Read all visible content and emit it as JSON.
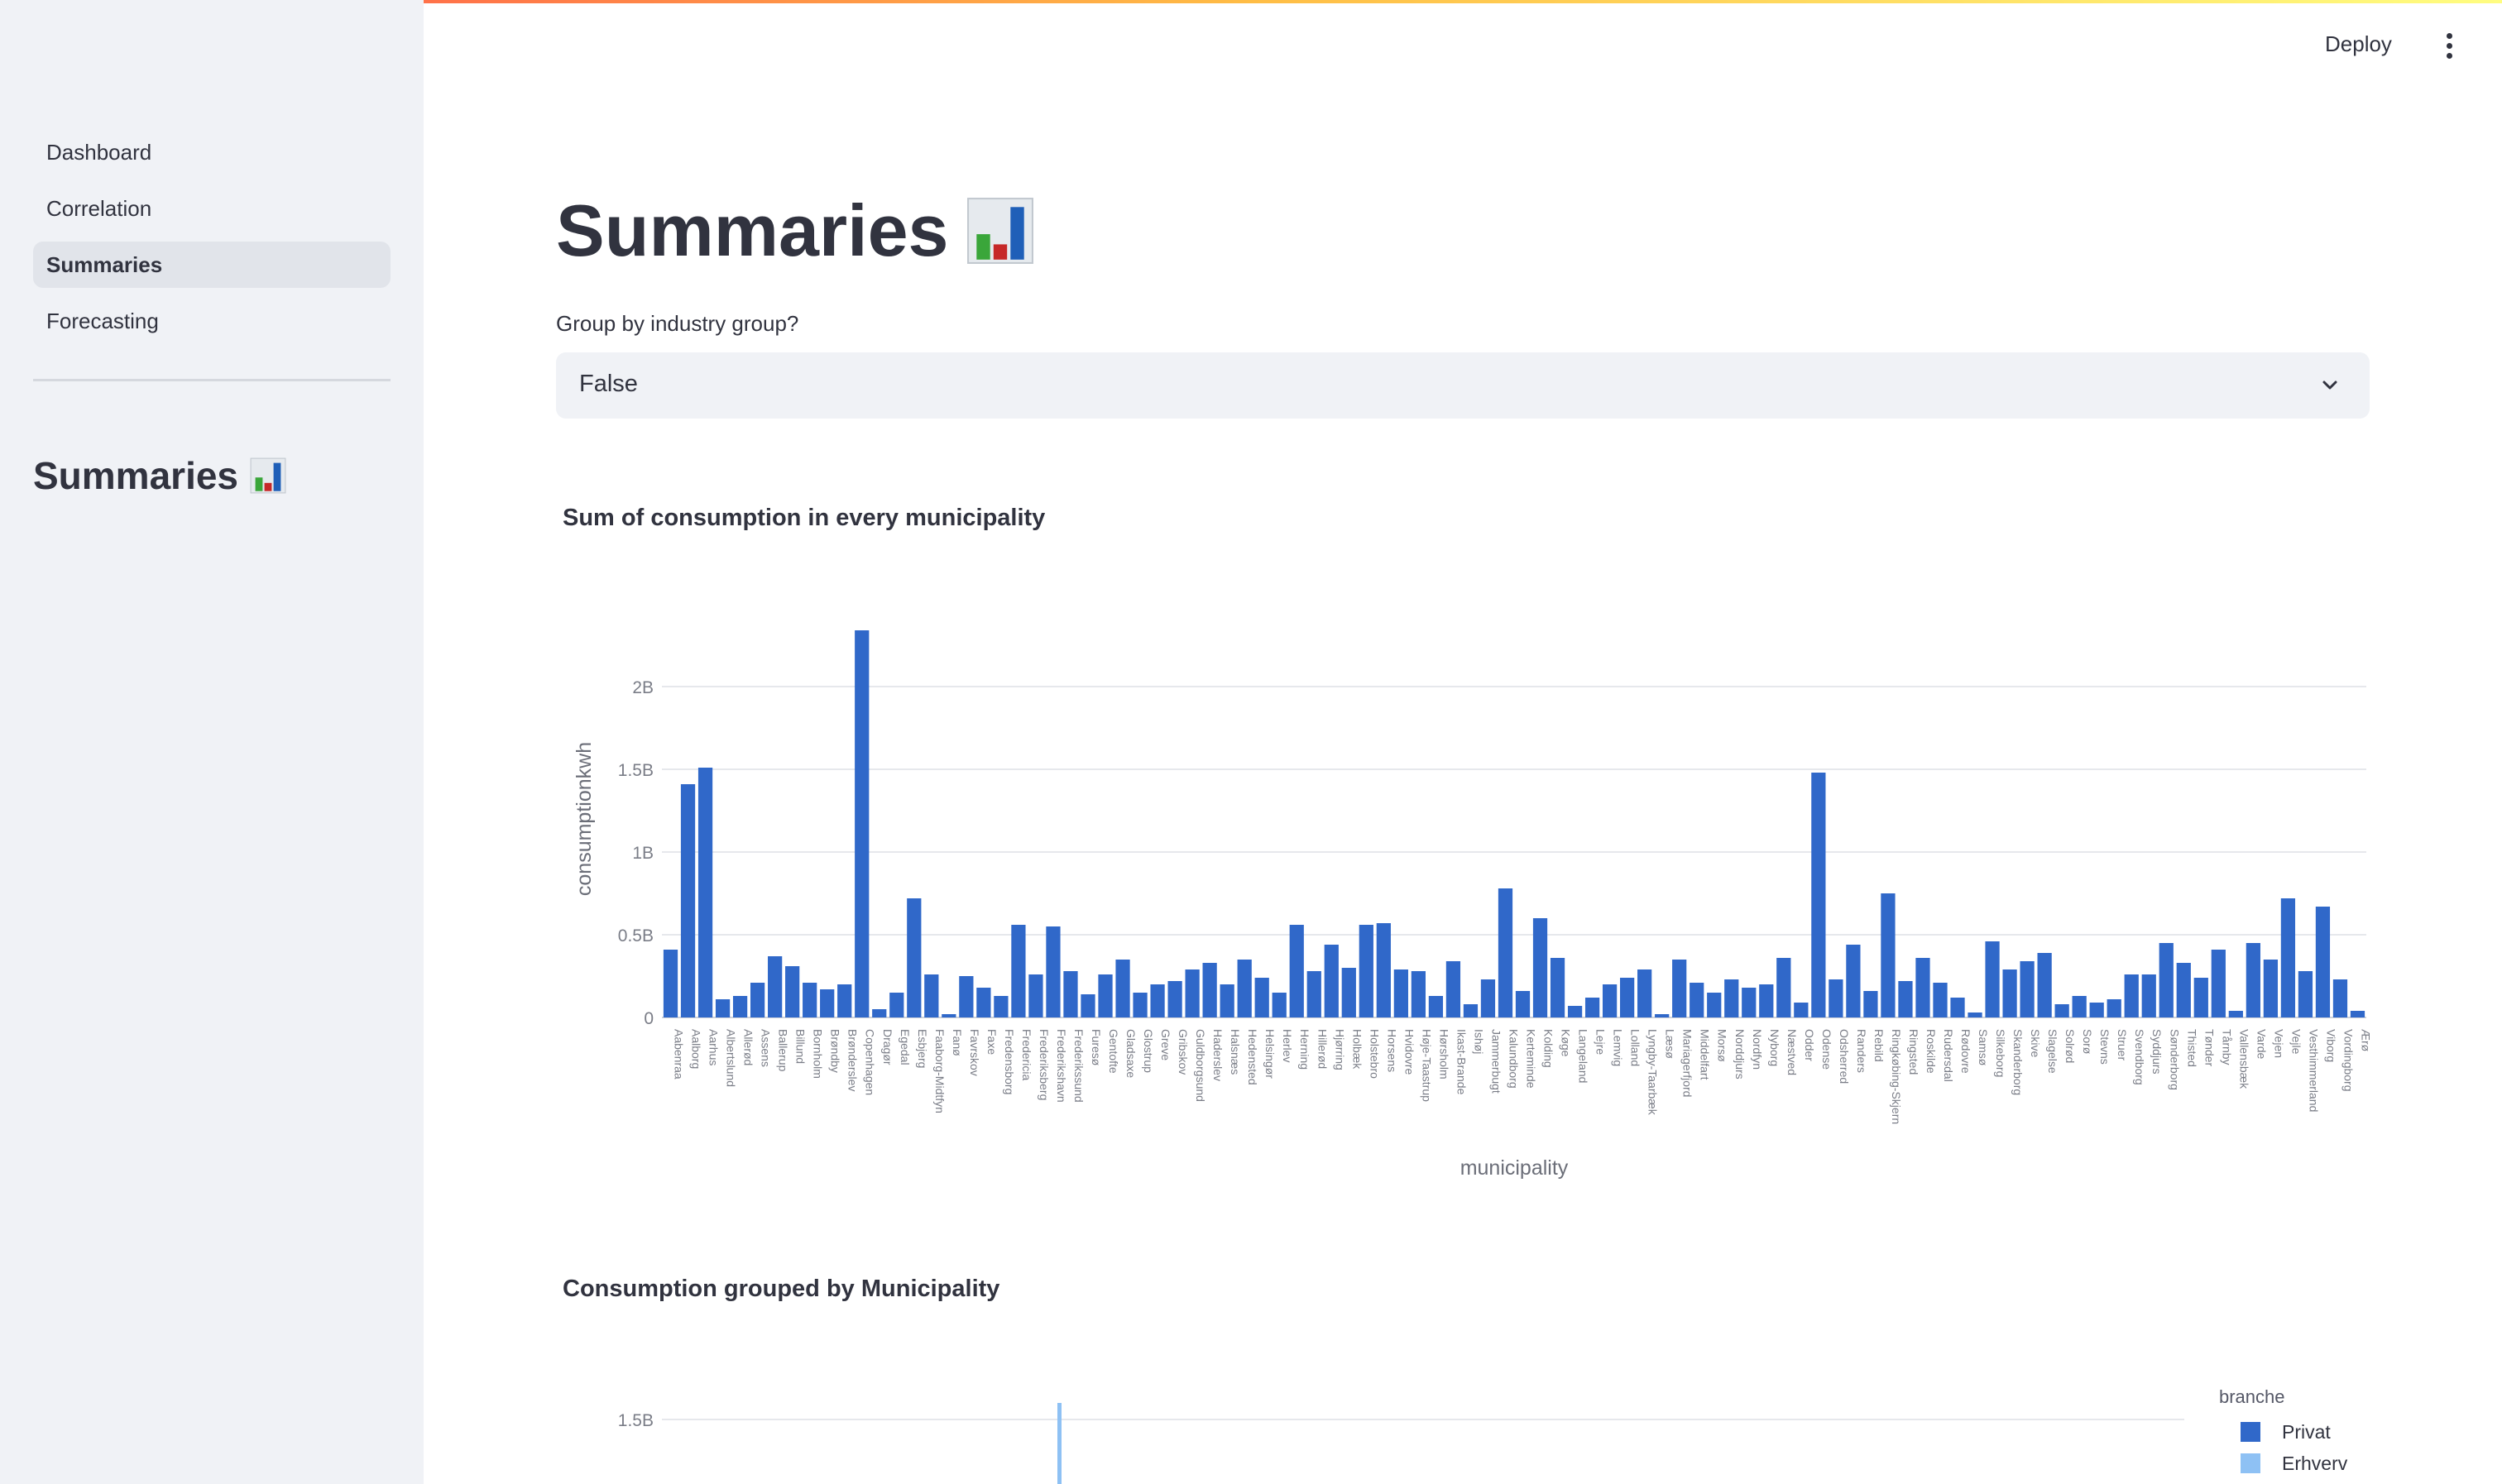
{
  "sidebar": {
    "nav": [
      {
        "label": "Dashboard",
        "active": false
      },
      {
        "label": "Correlation",
        "active": false
      },
      {
        "label": "Summaries",
        "active": true
      },
      {
        "label": "Forecasting",
        "active": false
      }
    ],
    "title": "Summaries",
    "title_icon": "bar-chart-emoji-icon"
  },
  "header": {
    "deploy_label": "Deploy",
    "menu_icon": "kebab-menu-icon"
  },
  "main": {
    "title": "Summaries",
    "title_icon": "bar-chart-emoji-icon",
    "group_select": {
      "label": "Group by industry group?",
      "value": "False"
    },
    "chart1_title": "Sum of consumption in every municipality",
    "chart2_title": "Consumption grouped by Municipality"
  },
  "colors": {
    "bar": "#3068c9",
    "erhverv": "#8ec1f4",
    "accent": "#ff4b4b"
  },
  "chart_data": [
    {
      "type": "bar",
      "title": "Sum of consumption in every municipality",
      "xlabel": "municipality",
      "ylabel": "consumptionkwh",
      "ylim": [
        0,
        2400000000
      ],
      "yticks": [
        0,
        500000000,
        1000000000,
        1500000000,
        2000000000
      ],
      "ytick_labels": [
        "0",
        "0.5B",
        "1B",
        "1.5B",
        "2B"
      ],
      "grid": true,
      "categories": [
        "Aabenraa",
        "Aalborg",
        "Aarhus",
        "Albertslund",
        "Allerød",
        "Assens",
        "Ballerup",
        "Billund",
        "Bornholm",
        "Brøndby",
        "Brønderslev",
        "Copenhagen",
        "Dragør",
        "Egedal",
        "Esbjerg",
        "Faaborg-Midtfyn",
        "Fanø",
        "Favrskov",
        "Faxe",
        "Fredensborg",
        "Fredericia",
        "Frederiksberg",
        "Frederikshavn",
        "Frederikssund",
        "Furesø",
        "Gentofte",
        "Gladsaxe",
        "Glostrup",
        "Greve",
        "Gribskov",
        "Guldborgsund",
        "Haderslev",
        "Halsnæs",
        "Hedensted",
        "Helsingør",
        "Herlev",
        "Herning",
        "Hillerød",
        "Hjørring",
        "Holbæk",
        "Holstebro",
        "Horsens",
        "Hvidovre",
        "Høje-Taastrup",
        "Hørsholm",
        "Ikast-Brande",
        "Ishøj",
        "Jammerbugt",
        "Kalundborg",
        "Kerteminde",
        "Kolding",
        "Køge",
        "Langeland",
        "Lejre",
        "Lemvig",
        "Lolland",
        "Lyngby-Taarbæk",
        "Læsø",
        "Mariagerfjord",
        "Middelfart",
        "Morsø",
        "Norddjurs",
        "Nordfyn",
        "Nyborg",
        "Næstved",
        "Odder",
        "Odense",
        "Odsherred",
        "Randers",
        "Rebild",
        "Ringkøbing-Skjern",
        "Ringsted",
        "Roskilde",
        "Rudersdal",
        "Rødovre",
        "Samsø",
        "Silkeborg",
        "Skanderborg",
        "Skive",
        "Slagelse",
        "Solrød",
        "Sorø",
        "Stevns",
        "Struer",
        "Svendborg",
        "Syddjurs",
        "Sønderborg",
        "Thisted",
        "Tønder",
        "Tårnby",
        "Vallensbæk",
        "Varde",
        "Vejen",
        "Vejle",
        "Vesthimmerland",
        "Viborg",
        "Vordingborg",
        "Ærø"
      ],
      "values": [
        410000000,
        1410000000,
        1510000000,
        110000000,
        130000000,
        210000000,
        370000000,
        310000000,
        210000000,
        170000000,
        200000000,
        2340000000,
        50000000,
        150000000,
        720000000,
        260000000,
        20000000,
        250000000,
        180000000,
        130000000,
        560000000,
        260000000,
        550000000,
        280000000,
        140000000,
        260000000,
        350000000,
        150000000,
        200000000,
        220000000,
        290000000,
        330000000,
        200000000,
        350000000,
        240000000,
        150000000,
        560000000,
        280000000,
        440000000,
        300000000,
        560000000,
        570000000,
        290000000,
        280000000,
        130000000,
        340000000,
        80000000,
        230000000,
        780000000,
        160000000,
        600000000,
        360000000,
        70000000,
        120000000,
        200000000,
        240000000,
        290000000,
        20000000,
        350000000,
        210000000,
        150000000,
        230000000,
        180000000,
        200000000,
        360000000,
        90000000,
        1480000000,
        230000000,
        440000000,
        160000000,
        750000000,
        220000000,
        360000000,
        210000000,
        120000000,
        30000000,
        460000000,
        290000000,
        340000000,
        390000000,
        80000000,
        130000000,
        90000000,
        110000000,
        260000000,
        260000000,
        450000000,
        330000000,
        240000000,
        410000000,
        40000000,
        450000000,
        350000000,
        720000000,
        280000000,
        670000000,
        230000000,
        40000000
      ]
    },
    {
      "type": "bar",
      "title": "Consumption grouped by Municipality",
      "yticks": [
        1500000000
      ],
      "ytick_labels": [
        "1.5B"
      ],
      "legend_title": "branche",
      "legend_position": "right",
      "series": [
        {
          "name": "Privat",
          "color": "#3068c9"
        },
        {
          "name": "Erhverv",
          "color": "#8ec1f4"
        }
      ]
    }
  ]
}
